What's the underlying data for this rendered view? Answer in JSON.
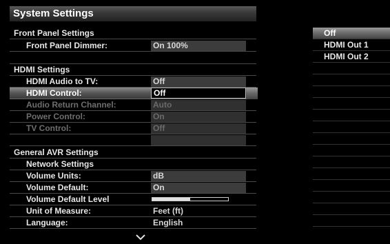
{
  "title": "System Settings",
  "sections": {
    "front_panel": {
      "header": "Front Panel Settings",
      "dimmer_label": "Front Panel Dimmer:",
      "dimmer_value": "On 100%"
    },
    "hdmi": {
      "header": "HDMI Settings",
      "audio_to_tv_label": "HDMI Audio to TV:",
      "audio_to_tv_value": "Off",
      "control_label": "HDMI Control:",
      "control_value": "Off",
      "arc_label": "Audio Return Channel:",
      "arc_value": "Auto",
      "power_label": "Power Control:",
      "power_value": "On",
      "tv_control_label": "TV Control:",
      "tv_control_value": "Off"
    },
    "general": {
      "header": "General AVR Settings",
      "network_label": "Network Settings",
      "volume_units_label": "Volume Units:",
      "volume_units_value": "dB",
      "volume_default_label": "Volume Default:",
      "volume_default_value": "On",
      "volume_default_level_label": "Volume Default Level",
      "volume_default_level_fraction": 0.5,
      "unit_of_measure_label": "Unit of Measure:",
      "unit_of_measure_value": "Feet (ft)",
      "language_label": "Language:",
      "language_value": "English"
    }
  },
  "options": {
    "items": [
      "Off",
      "HDMI Out 1",
      "HDMI Out 2"
    ],
    "selected": "Off"
  },
  "icons": {
    "scroll_down": "chevron-down-icon"
  },
  "colors": {
    "background": "#000000",
    "highlight": "#8a8a8a",
    "value_field": "#3c3c3c"
  }
}
